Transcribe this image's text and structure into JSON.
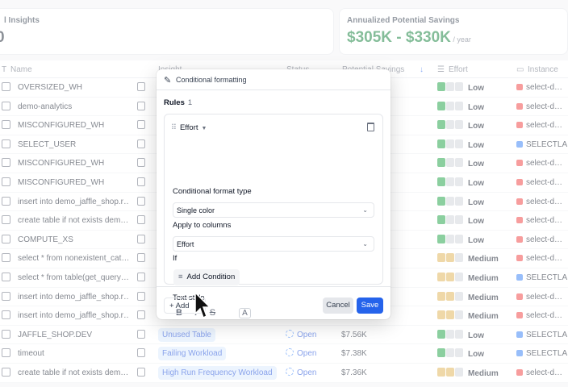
{
  "cards": [
    {
      "label": "l Insights",
      "value": "0",
      "sub": ""
    },
    {
      "label": "Annualized Potential Savings",
      "value": "$305K - $330K",
      "sub": " / year"
    }
  ],
  "table": {
    "headers": {
      "name": "Name",
      "insight": "Insight",
      "status": "Status",
      "savings": "Potential Savings",
      "effort": "Effort",
      "instance": "Instance"
    },
    "rows": [
      {
        "name": "OVERSIZED_WH",
        "insight": "",
        "status": "",
        "saving": "",
        "effort": "Low",
        "level": 1,
        "instance": "select-d…",
        "inst_color": "#ef4444"
      },
      {
        "name": "demo-analytics",
        "insight": "",
        "status": "",
        "saving": "",
        "effort": "Low",
        "level": 1,
        "instance": "select-d…",
        "inst_color": "#ef4444"
      },
      {
        "name": "MISCONFIGURED_WH",
        "insight": "",
        "status": "",
        "saving": "",
        "effort": "Low",
        "level": 1,
        "instance": "select-d…",
        "inst_color": "#ef4444"
      },
      {
        "name": "SELECT_USER",
        "insight": "",
        "status": "",
        "saving": "",
        "effort": "Low",
        "level": 1,
        "instance": "SELECTLA…",
        "inst_color": "#3b82f6"
      },
      {
        "name": "MISCONFIGURED_WH",
        "insight": "",
        "status": "",
        "saving": "",
        "effort": "Low",
        "level": 1,
        "instance": "select-d…",
        "inst_color": "#ef4444"
      },
      {
        "name": "MISCONFIGURED_WH",
        "insight": "",
        "status": "",
        "saving": "",
        "effort": "Low",
        "level": 1,
        "instance": "select-d…",
        "inst_color": "#ef4444"
      },
      {
        "name": "insert into demo_jaffle_shop.r…",
        "insight": "",
        "status": "",
        "saving": "",
        "effort": "Low",
        "level": 1,
        "instance": "select-d…",
        "inst_color": "#ef4444"
      },
      {
        "name": "create table if not exists dem…",
        "insight": "",
        "status": "",
        "saving": "",
        "effort": "Low",
        "level": 1,
        "instance": "select-d…",
        "inst_color": "#ef4444"
      },
      {
        "name": "COMPUTE_XS",
        "insight": "",
        "status": "",
        "saving": "",
        "effort": "Low",
        "level": 1,
        "instance": "select-d…",
        "inst_color": "#ef4444"
      },
      {
        "name": "select * from nonexistent_cat…",
        "insight": "",
        "status": "",
        "saving": "",
        "effort": "Medium",
        "level": 2,
        "instance": "select-d…",
        "inst_color": "#ef4444"
      },
      {
        "name": "select * from table(get_query…",
        "insight": "",
        "status": "",
        "saving": "",
        "effort": "Medium",
        "level": 2,
        "instance": "SELECTLA…",
        "inst_color": "#3b82f6"
      },
      {
        "name": "insert into demo_jaffle_shop.r…",
        "insight": "",
        "status": "",
        "saving": "",
        "effort": "Medium",
        "level": 2,
        "instance": "select-d…",
        "inst_color": "#ef4444"
      },
      {
        "name": "insert into demo_jaffle_shop.r…",
        "insight": "",
        "status": "",
        "saving": "",
        "effort": "Medium",
        "level": 2,
        "instance": "select-d…",
        "inst_color": "#ef4444"
      },
      {
        "name": "JAFFLE_SHOP.DEV",
        "insight": "Unused Table",
        "status": "Open",
        "saving": "$7.56K",
        "effort": "Low",
        "level": 1,
        "instance": "SELECTLA…",
        "inst_color": "#3b82f6"
      },
      {
        "name": "timeout",
        "insight": "Failing Workload",
        "status": "Open",
        "saving": "$7.38K",
        "effort": "Low",
        "level": 1,
        "instance": "SELECTLA…",
        "inst_color": "#3b82f6"
      },
      {
        "name": "create table if not exists dem…",
        "insight": "High Run Frequency Workload",
        "status": "Open",
        "saving": "$7.36K",
        "effort": "Medium",
        "level": 2,
        "instance": "select-d…",
        "inst_color": "#ef4444"
      }
    ]
  },
  "modal": {
    "title": "Conditional formatting",
    "rules_label": "Rules",
    "rules_count": "1",
    "rule_column": "Effort",
    "format_type_label": "Conditional format type",
    "format_type_value": "Single color",
    "apply_label": "Apply to columns",
    "apply_value": "Effort",
    "if_label": "If",
    "add_condition": "Add Condition",
    "text_style_label": "Text style",
    "text_style_options": [
      "B",
      "I",
      "S",
      "A"
    ],
    "add_label": "Add",
    "cancel_label": "Cancel",
    "save_label": "Save"
  },
  "colors": {
    "low_bar": "#22a447",
    "medium_bar": "#e0b458",
    "bar_off": "#d1d5db",
    "primary": "#2563eb",
    "savings_green": "#15803d"
  }
}
